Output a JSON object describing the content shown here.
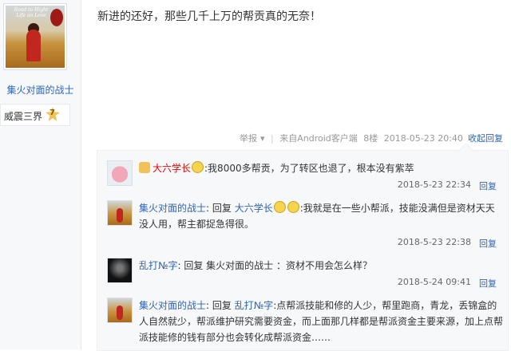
{
  "post": {
    "author": {
      "username": "集火对面的战士",
      "avatar_caption": "Road to Hight Life an Love",
      "badge_label": "威震三界",
      "level": "7"
    },
    "content": "新进的还好，那些几千上万的帮贡真的无奈！",
    "meta": {
      "report": "举报",
      "source": "来自Android客户端",
      "floor": "8楼",
      "time": "2018-05-23 20:40"
    },
    "collapse_label": "收起回复"
  },
  "replies": [
    {
      "avatar": "pig-avatar",
      "username": "大六学长",
      "text": ":我8000多帮贡，为了转区也退了，根本没有紫萃",
      "time": "2018-5-23 22:34",
      "reply_label": "回复"
    },
    {
      "avatar": "girl-avatar",
      "username": "集火对面的战士",
      "prefix": ": 回复 ",
      "target": "大六学长",
      "text": ":我就是在一些小帮派，技能没满但是资材天天没人用，帮主都捉急得很。",
      "time": "2018-5-23 22:38",
      "reply_label": "回复"
    },
    {
      "avatar": "dark-avatar",
      "username": "乱打№字",
      "text": ": 回复 集火对面的战士 ：资材不用会怎么样？",
      "time": "2018-5-24 09:41",
      "reply_label": "回复"
    },
    {
      "avatar": "girl-avatar",
      "username": "集火对面的战士",
      "prefix": ": 回复 ",
      "target": "乱打№字",
      "text": ":点帮派技能和修的人少，帮里跑商，青龙，丢锦盒的人自然就少，帮派维护研究需要资金，而上面那几样都是帮派资金主要来源，加上点帮派技能修的钱有部分也会转化成帮派资金……"
    }
  ]
}
